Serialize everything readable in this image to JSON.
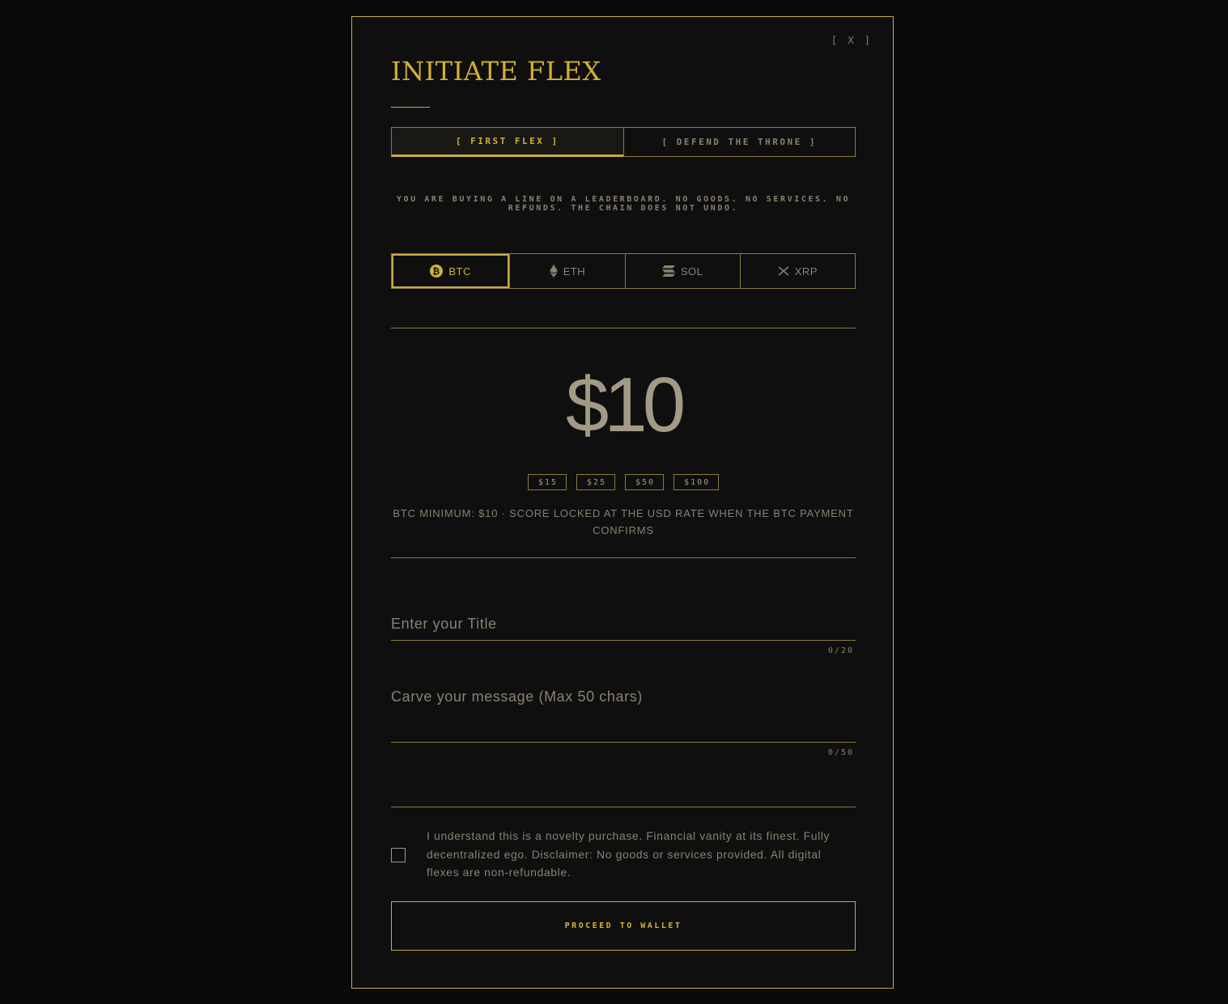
{
  "modal": {
    "close_label": "[ X ]",
    "title": "INITIATE FLEX"
  },
  "tabs": [
    {
      "label": "[ FIRST FLEX ]",
      "active": true
    },
    {
      "label": "[ DEFEND THE THRONE ]",
      "active": false
    }
  ],
  "disclaimer": "YOU ARE BUYING A LINE ON A LEADERBOARD. NO GOODS. NO SERVICES. NO REFUNDS. THE CHAIN DOES NOT UNDO.",
  "coins": [
    {
      "label": "BTC",
      "icon": "bitcoin-icon",
      "active": true
    },
    {
      "label": "ETH",
      "icon": "ethereum-icon",
      "active": false
    },
    {
      "label": "SOL",
      "icon": "solana-icon",
      "active": false
    },
    {
      "label": "XRP",
      "icon": "xrp-icon",
      "active": false
    }
  ],
  "amount": "$10",
  "presets": [
    "$15",
    "$25",
    "$50",
    "$100"
  ],
  "min_note": "BTC MINIMUM: $10 · SCORE LOCKED AT THE USD RATE WHEN THE BTC PAYMENT CONFIRMS",
  "title_field": {
    "placeholder": "Enter your Title",
    "value": "",
    "counter": "0/20"
  },
  "message_field": {
    "placeholder": "Carve your message (Max 50 chars)",
    "value": "",
    "counter": "0/50"
  },
  "consent": {
    "checked": false,
    "text": "I understand this is a novelty purchase. Financial vanity at its finest. Fully decentralized ego. Disclaimer: No goods or services provided. All digital flexes are non-refundable."
  },
  "proceed_label": "PROCEED TO WALLET",
  "colors": {
    "background": "#0a0a0a",
    "panel": "#0f0f0f",
    "gold": "#d4af37",
    "muted": "#8a8170"
  }
}
